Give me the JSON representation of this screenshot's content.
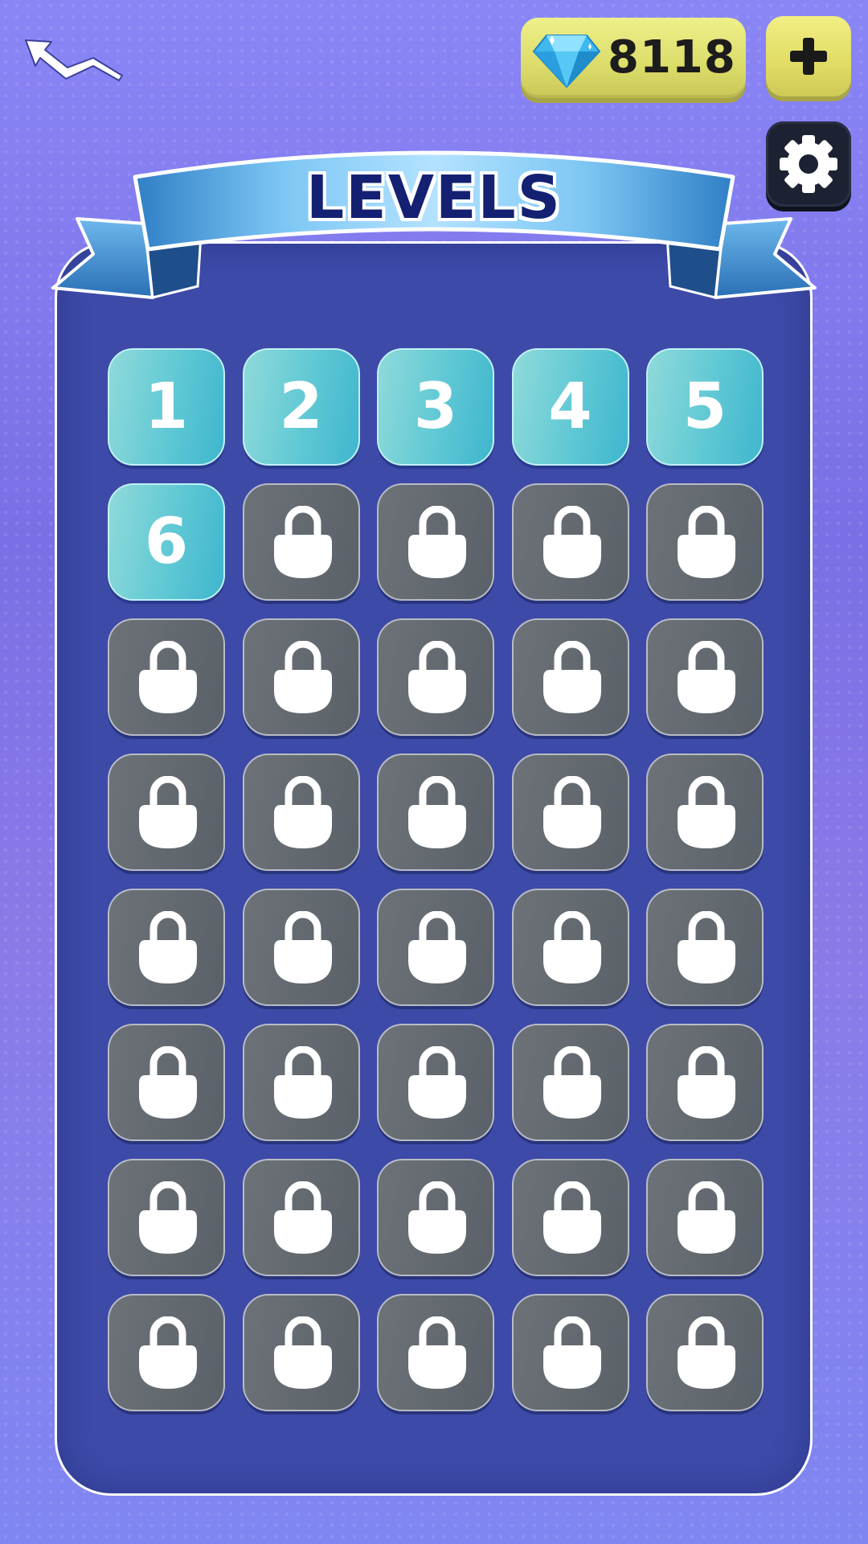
{
  "header": {
    "back_icon": "back-arrow-icon",
    "gem_icon": "diamond-icon",
    "gem_count": "8118",
    "add_icon": "plus-icon",
    "settings_icon": "gear-icon"
  },
  "title": "LEVELS",
  "colors": {
    "background": "#8a86f6",
    "panel": "#3d4aa8",
    "unlocked_tile": "#5fc8d4",
    "locked_tile": "#5b6168",
    "title_text": "#142172",
    "gem_counter": "#dcdc6a"
  },
  "levels": [
    {
      "label": "1",
      "locked": false
    },
    {
      "label": "2",
      "locked": false
    },
    {
      "label": "3",
      "locked": false
    },
    {
      "label": "4",
      "locked": false
    },
    {
      "label": "5",
      "locked": false
    },
    {
      "label": "6",
      "locked": false
    },
    {
      "label": "",
      "locked": true
    },
    {
      "label": "",
      "locked": true
    },
    {
      "label": "",
      "locked": true
    },
    {
      "label": "",
      "locked": true
    },
    {
      "label": "",
      "locked": true
    },
    {
      "label": "",
      "locked": true
    },
    {
      "label": "",
      "locked": true
    },
    {
      "label": "",
      "locked": true
    },
    {
      "label": "",
      "locked": true
    },
    {
      "label": "",
      "locked": true
    },
    {
      "label": "",
      "locked": true
    },
    {
      "label": "",
      "locked": true
    },
    {
      "label": "",
      "locked": true
    },
    {
      "label": "",
      "locked": true
    },
    {
      "label": "",
      "locked": true
    },
    {
      "label": "",
      "locked": true
    },
    {
      "label": "",
      "locked": true
    },
    {
      "label": "",
      "locked": true
    },
    {
      "label": "",
      "locked": true
    },
    {
      "label": "",
      "locked": true
    },
    {
      "label": "",
      "locked": true
    },
    {
      "label": "",
      "locked": true
    },
    {
      "label": "",
      "locked": true
    },
    {
      "label": "",
      "locked": true
    },
    {
      "label": "",
      "locked": true
    },
    {
      "label": "",
      "locked": true
    },
    {
      "label": "",
      "locked": true
    },
    {
      "label": "",
      "locked": true
    },
    {
      "label": "",
      "locked": true
    },
    {
      "label": "",
      "locked": true
    },
    {
      "label": "",
      "locked": true
    },
    {
      "label": "",
      "locked": true
    },
    {
      "label": "",
      "locked": true
    },
    {
      "label": "",
      "locked": true
    }
  ]
}
